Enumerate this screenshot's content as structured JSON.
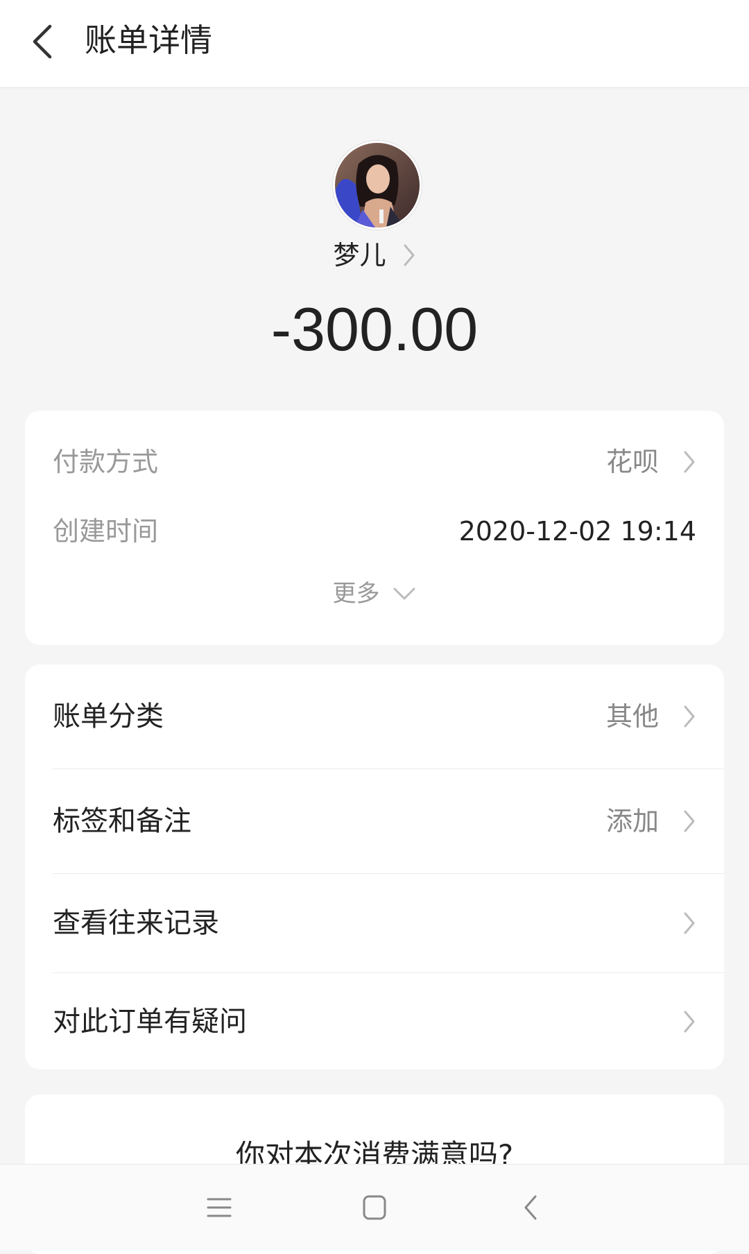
{
  "header": {
    "title": "账单详情",
    "back_icon": "chevron-left-icon"
  },
  "profile": {
    "name": "梦儿",
    "amount": "-300.00"
  },
  "details": {
    "payment_method_label": "付款方式",
    "payment_method_value": "花呗",
    "created_time_label": "创建时间",
    "created_time_value": "2020-12-02 19:14",
    "more_label": "更多"
  },
  "actions": [
    {
      "label": "账单分类",
      "value": "其他"
    },
    {
      "label": "标签和备注",
      "value": "添加"
    },
    {
      "label": "查看往来记录",
      "value": ""
    },
    {
      "label": "对此订单有疑问",
      "value": ""
    }
  ],
  "survey": {
    "question": "你对本次消费满意吗?"
  },
  "system_nav": {
    "menu_icon": "menu-icon",
    "home_icon": "home-square-icon",
    "back_icon": "back-triangle-icon"
  },
  "colors": {
    "background": "#f5f5f5",
    "card": "#ffffff",
    "primary_text": "#222222",
    "secondary_text": "#999999"
  }
}
